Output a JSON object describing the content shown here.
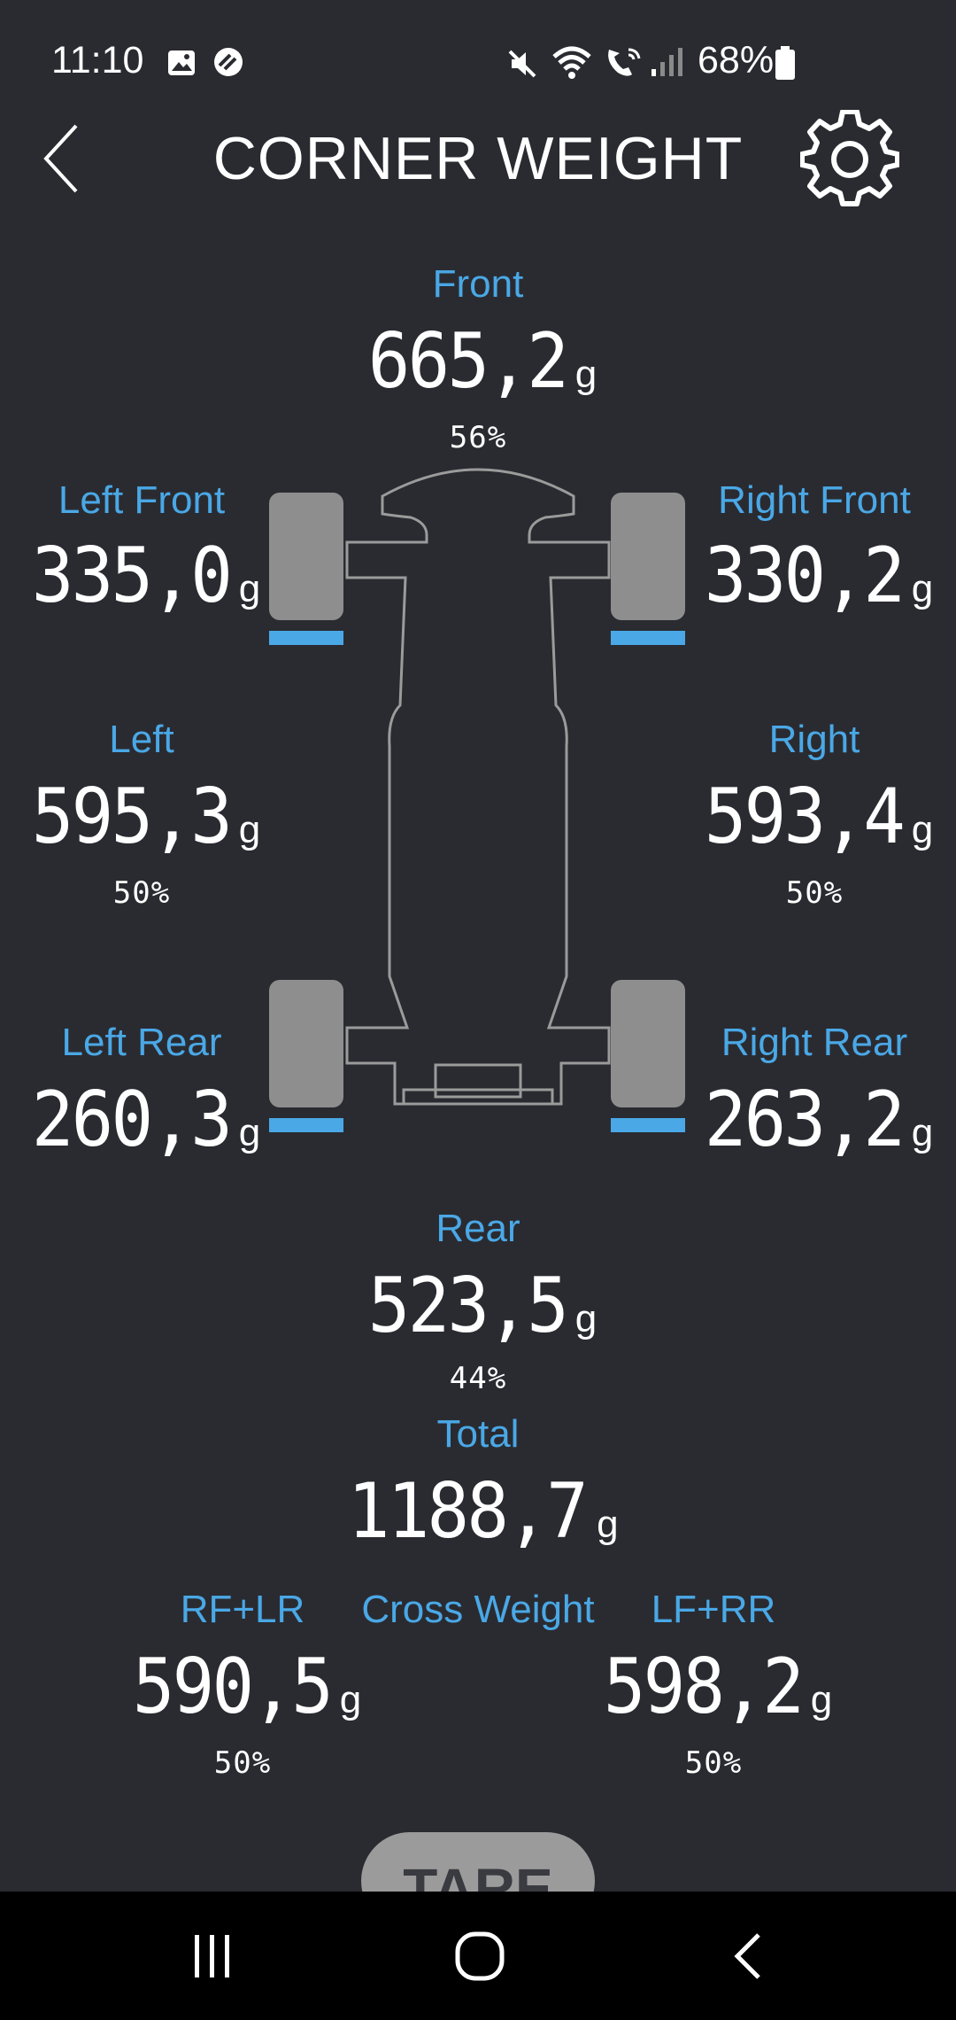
{
  "status": {
    "time": "11:10",
    "battery": "68%",
    "icons": [
      "gallery-icon",
      "sync-icon",
      "mute-icon",
      "wifi-icon",
      "wifi-calling-icon",
      "signal-icon",
      "battery-icon"
    ]
  },
  "header": {
    "title": "CORNER WEIGHT",
    "back_icon": "chevron-left-icon",
    "settings_icon": "gear-icon"
  },
  "accent_color": "#4aa8e6",
  "background_color": "#2a2b31",
  "unit": "g",
  "front": {
    "label": "Front",
    "value": "665,2",
    "percent": "56%"
  },
  "left_front": {
    "label": "Left Front",
    "value": "335,0"
  },
  "right_front": {
    "label": "Right Front",
    "value": "330,2"
  },
  "left": {
    "label": "Left",
    "value": "595,3",
    "percent": "50%"
  },
  "right": {
    "label": "Right",
    "value": "593,4",
    "percent": "50%"
  },
  "left_rear": {
    "label": "Left Rear",
    "value": "260,3"
  },
  "right_rear": {
    "label": "Right Rear",
    "value": "263,2"
  },
  "rear": {
    "label": "Rear",
    "value": "523,5",
    "percent": "44%"
  },
  "total": {
    "label": "Total",
    "value": "1188,7"
  },
  "cross": {
    "title": "Cross Weight",
    "rf_lr": {
      "label": "RF+LR",
      "value": "590,5",
      "percent": "50%"
    },
    "lf_rr": {
      "label": "LF+RR",
      "value": "598,2",
      "percent": "50%"
    }
  },
  "tare_label": "TARE",
  "navbar": {
    "recent_icon": "recent-apps-icon",
    "home_icon": "home-icon",
    "back_icon": "back-icon"
  }
}
